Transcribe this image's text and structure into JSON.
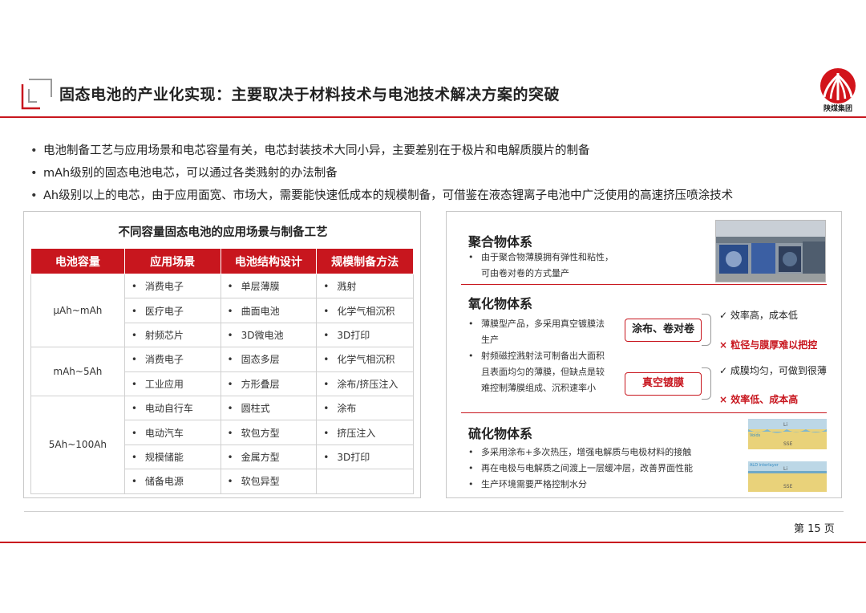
{
  "header": {
    "title": "固态电池的产业化实现：主要取决于材料技术与电池技术解决方案的突破",
    "brand": "陕煤集团"
  },
  "bullets": [
    "电池制备工艺与应用场景和电芯容量有关，电芯封装技术大同小异，主要差别在于极片和电解质膜片的制备",
    "mAh级别的固态电池电芯，可以通过各类溅射的办法制备",
    "Ah级别以上的电芯，由于应用面宽、市场大，需要能快速低成本的规模制备，可借鉴在液态锂离子电池中广泛使用的高速挤压喷涂技术"
  ],
  "table": {
    "title": "不同容量固态电池的应用场景与制备工艺",
    "headers": [
      "电池容量",
      "应用场景",
      "电池结构设计",
      "规模制备方法"
    ],
    "bullet": "•",
    "groups": [
      {
        "capacity": "μAh~mAh",
        "rows": [
          [
            "消费电子",
            "单层薄膜",
            "溅射"
          ],
          [
            "医疗电子",
            "曲面电池",
            "化学气相沉积"
          ],
          [
            "射频芯片",
            "3D微电池",
            "3D打印"
          ]
        ]
      },
      {
        "capacity": "mAh~5Ah",
        "rows": [
          [
            "消费电子",
            "固态多层",
            "化学气相沉积"
          ],
          [
            "工业应用",
            "方形叠层",
            "涂布/挤压注入"
          ]
        ]
      },
      {
        "capacity": "5Ah~100Ah",
        "rows": [
          [
            "电动自行车",
            "圆柱式",
            "涂布"
          ],
          [
            "电动汽车",
            "软包方型",
            "挤压注入"
          ],
          [
            "规模储能",
            "金属方型",
            "3D打印"
          ],
          [
            "储备电源",
            "软包异型",
            ""
          ]
        ]
      }
    ]
  },
  "polymer": {
    "title": "聚合物体系",
    "lines": [
      "由于聚合物薄膜拥有弹性和粘性，",
      "可由卷对卷的方式量产"
    ]
  },
  "oxide": {
    "title": "氧化物体系",
    "lines": [
      "薄膜型产品，多采用真空镀膜法",
      "生产",
      "射频磁控溅射法可制备出大面积",
      "且表面均匀的薄膜，但缺点是较",
      "难控制薄膜组成、沉积速率小"
    ],
    "tag1": "涂布、卷对卷",
    "tag2": "真空镀膜",
    "pro1": "效率高，成本低",
    "con1": "粒径与膜厚难以把控",
    "pro2": "成膜均匀，可做到很薄",
    "con2": "效率低、成本高",
    "check": "✓",
    "cross": "×"
  },
  "sulfide": {
    "title": "硫化物体系",
    "lines": [
      "多采用涂布+多次热压，增强电解质与电极材料的接触",
      "再在电极与电解质之间渡上一层缓冲层，改善界面性能",
      "生产环境需要严格控制水分"
    ],
    "img1_labels": [
      "Li",
      "Voids",
      "SSE"
    ],
    "img2_labels": [
      "ALD interlayer",
      "Li",
      "SSE"
    ]
  },
  "footer": {
    "page": "第 15 页"
  },
  "colors": {
    "accent": "#c8161e"
  }
}
